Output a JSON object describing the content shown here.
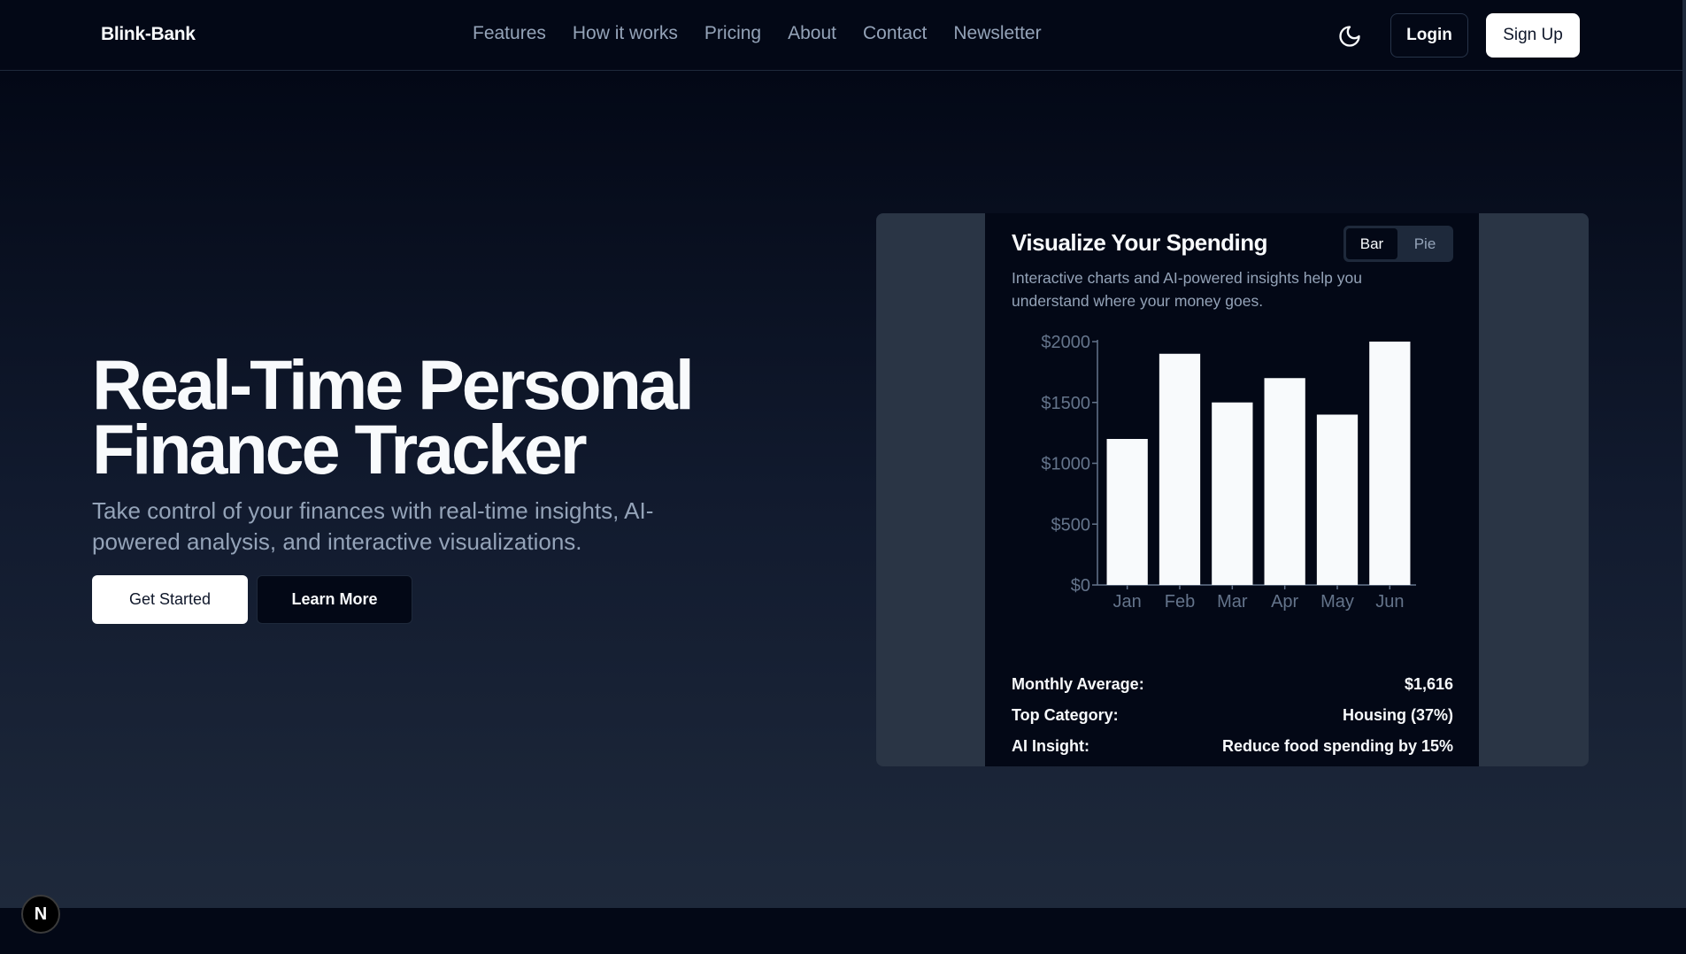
{
  "navbar": {
    "brand": "Blink-Bank",
    "links": [
      "Features",
      "How it works",
      "Pricing",
      "About",
      "Contact",
      "Newsletter"
    ],
    "theme_icon": "moon-icon",
    "login_label": "Login",
    "signup_label": "Sign Up"
  },
  "hero": {
    "title_line1": "Real-Time Personal",
    "title_line2": "Finance Tracker",
    "subtitle": "Take control of your finances with real-time insights, AI-powered analysis, and interactive visualizations.",
    "primary_label": "Get Started",
    "secondary_label": "Learn More"
  },
  "card": {
    "title": "Visualize Your Spending",
    "toggle": [
      "Bar",
      "Pie"
    ],
    "toggle_selected": "Bar",
    "description": "Interactive charts and AI-powered insights help you understand where your money goes.",
    "stats": [
      {
        "label": "Monthly Average:",
        "value": "$1,616"
      },
      {
        "label": "Top Category:",
        "value": "Housing (37%)"
      },
      {
        "label": "AI Insight:",
        "value": "Reduce food spending by 15%"
      }
    ]
  },
  "chart_data": {
    "type": "bar",
    "categories": [
      "Jan",
      "Feb",
      "Mar",
      "Apr",
      "May",
      "Jun"
    ],
    "values": [
      1200,
      1900,
      1500,
      1700,
      1400,
      2000
    ],
    "ylim": [
      0,
      2000
    ],
    "yticks": [
      0,
      500,
      1000,
      1500,
      2000
    ],
    "ytick_labels": [
      "$0",
      "$500",
      "$1000",
      "$1500",
      "$2000"
    ],
    "grid": false,
    "bar_color": "#f8fafc",
    "axis_color": "#64748b"
  },
  "badge": {
    "label": "N",
    "icon": "nextjs-logo-icon"
  },
  "colors": {
    "background": "#030816",
    "accent": "#ffffff",
    "muted_text": "#94a3b8"
  }
}
